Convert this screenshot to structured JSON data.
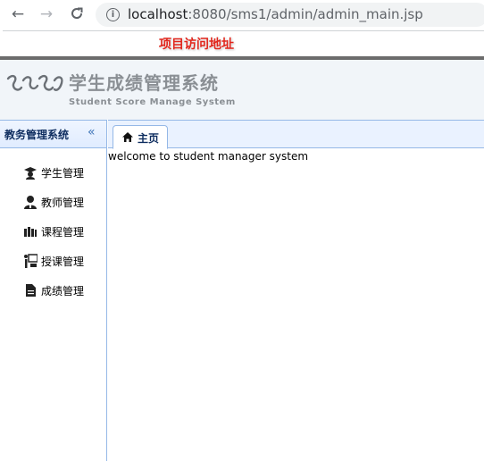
{
  "browser": {
    "url_host": "localhost",
    "url_rest": ":8080/sms1/admin/admin_main.jsp",
    "back": "←",
    "forward": "→",
    "reload": "C",
    "info": "i"
  },
  "annotation": {
    "label": "项目访问地址",
    "color": "#e1261c"
  },
  "header": {
    "logo_text": "ЭЄЭЄ",
    "title": "学生成绩管理系统",
    "subtitle": "Student Score Manage System"
  },
  "sidebar": {
    "title": "教务管理系统",
    "collapse_glyph": "«",
    "items": [
      {
        "label": "学生管理",
        "icon": "student-cap-icon"
      },
      {
        "label": "教师管理",
        "icon": "teacher-icon"
      },
      {
        "label": "课程管理",
        "icon": "books-icon"
      },
      {
        "label": "授课管理",
        "icon": "lecture-icon"
      },
      {
        "label": "成绩管理",
        "icon": "document-icon"
      }
    ]
  },
  "main": {
    "tab_label": "主页",
    "welcome": "welcome to student manager system"
  },
  "colors": {
    "accent": "#95b8e7",
    "header_bg": "#f1f5f9",
    "sidebar_title": "#0e2d5f"
  }
}
